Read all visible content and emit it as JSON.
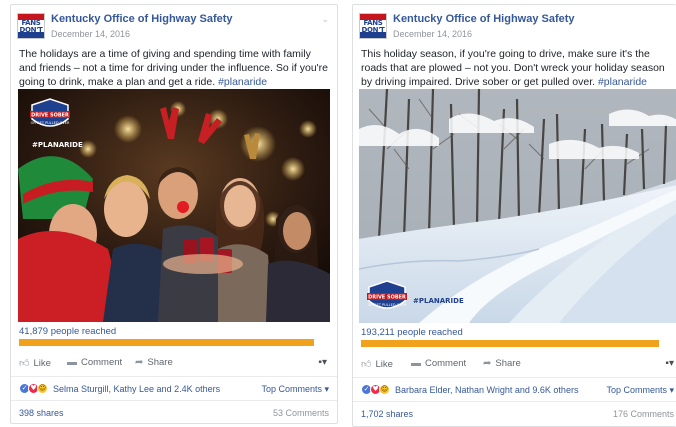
{
  "posts": [
    {
      "page_name": "Kentucky Office of Highway Safety",
      "avatar_text": "FANS DON'T LET FANS",
      "date": "December 14, 2016",
      "text": "The holidays are a time of giving and spending time with family and friends – not a time for driving under the influence. So if you're going to drink, make a plan and get a ride.",
      "hashtag": "#planaride",
      "photo": {
        "logo_line1": "DRIVE SOBER",
        "logo_line2": "OR GET PULLED OVER",
        "tag": "#PLANARIDE"
      },
      "reach_text": "41,879 people reached",
      "reach_fraction": 0.95,
      "actions": {
        "like": "Like",
        "comment": "Comment",
        "share": "Share"
      },
      "reactions_text": "Selma Sturgill, Kathy Lee and 2.4K others",
      "top_comments": "Top Comments ▾",
      "shares": "398 shares",
      "comments": "53 Comments"
    },
    {
      "page_name": "Kentucky Office of Highway Safety",
      "avatar_text": "FANS DON'T LET FANS",
      "date": "December 14, 2016",
      "text": "This holiday season, if you're going to drive, make sure it's the roads that are plowed – not you. Don't wreck your holiday season by driving impaired. Drive sober or get pulled over.",
      "hashtag": "#planaride",
      "photo": {
        "logo_line1": "DRIVE SOBER",
        "logo_line2": "OR GET PULLED OVER",
        "tag": "#PLANARIDE"
      },
      "reach_text": "193,211 people reached",
      "reach_fraction": 0.97,
      "actions": {
        "like": "Like",
        "comment": "Comment",
        "share": "Share"
      },
      "reactions_text": "Barbara Elder, Nathan Wright and 9.6K others",
      "top_comments": "Top Comments ▾",
      "shares": "1,702 shares",
      "comments": "176 Comments"
    }
  ],
  "colors": {
    "link": "#365899",
    "reach_bar": "#f0a21c",
    "muted": "#90949c"
  },
  "icons": [
    "chevron-down-icon",
    "like-icon",
    "comment-icon",
    "share-icon",
    "like-reaction-icon",
    "love-reaction-icon",
    "haha-reaction-icon",
    "boost-icon"
  ]
}
